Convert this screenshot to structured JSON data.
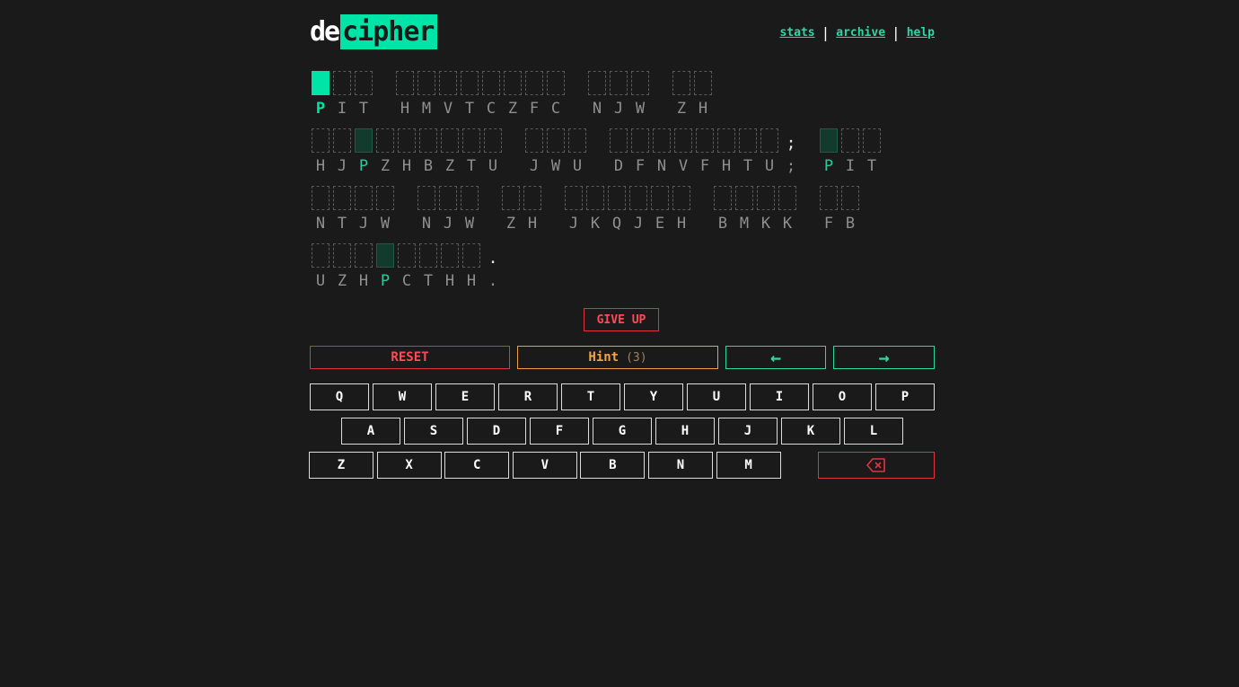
{
  "header": {
    "logo_de": "de",
    "logo_cipher": "cipher",
    "nav": {
      "stats": "stats",
      "archive": "archive",
      "help": "help",
      "sep": "|"
    }
  },
  "puzzle": {
    "lines": [
      {
        "words": [
          {
            "letters": [
              {
                "c": "P",
                "state": "active"
              },
              {
                "c": "I"
              },
              {
                "c": "T"
              }
            ]
          },
          {
            "letters": [
              {
                "c": "H"
              },
              {
                "c": "M"
              },
              {
                "c": "V"
              },
              {
                "c": "T"
              },
              {
                "c": "C"
              },
              {
                "c": "Z"
              },
              {
                "c": "F"
              },
              {
                "c": "C"
              }
            ]
          },
          {
            "letters": [
              {
                "c": "N"
              },
              {
                "c": "J"
              },
              {
                "c": "W"
              }
            ]
          },
          {
            "letters": [
              {
                "c": "Z"
              },
              {
                "c": "H"
              }
            ]
          }
        ]
      },
      {
        "words": [
          {
            "letters": [
              {
                "c": "H"
              },
              {
                "c": "J"
              },
              {
                "c": "P",
                "state": "match"
              },
              {
                "c": "Z"
              },
              {
                "c": "H"
              },
              {
                "c": "B"
              },
              {
                "c": "Z"
              },
              {
                "c": "T"
              },
              {
                "c": "U"
              }
            ]
          },
          {
            "letters": [
              {
                "c": "J"
              },
              {
                "c": "W"
              },
              {
                "c": "U"
              }
            ]
          },
          {
            "letters": [
              {
                "c": "D"
              },
              {
                "c": "F"
              },
              {
                "c": "N"
              },
              {
                "c": "V"
              },
              {
                "c": "F"
              },
              {
                "c": "H"
              },
              {
                "c": "T"
              },
              {
                "c": "U"
              }
            ],
            "punct": ";"
          },
          {
            "letters": [
              {
                "c": "P",
                "state": "match"
              },
              {
                "c": "I"
              },
              {
                "c": "T"
              }
            ]
          }
        ]
      },
      {
        "words": [
          {
            "letters": [
              {
                "c": "N"
              },
              {
                "c": "T"
              },
              {
                "c": "J"
              },
              {
                "c": "W"
              }
            ]
          },
          {
            "letters": [
              {
                "c": "N"
              },
              {
                "c": "J"
              },
              {
                "c": "W"
              }
            ]
          },
          {
            "letters": [
              {
                "c": "Z"
              },
              {
                "c": "H"
              }
            ]
          },
          {
            "letters": [
              {
                "c": "J"
              },
              {
                "c": "K"
              },
              {
                "c": "Q"
              },
              {
                "c": "J"
              },
              {
                "c": "E"
              },
              {
                "c": "H"
              }
            ]
          },
          {
            "letters": [
              {
                "c": "B"
              },
              {
                "c": "M"
              },
              {
                "c": "K"
              },
              {
                "c": "K"
              }
            ]
          },
          {
            "letters": [
              {
                "c": "F"
              },
              {
                "c": "B"
              }
            ]
          }
        ]
      },
      {
        "words": [
          {
            "letters": [
              {
                "c": "U"
              },
              {
                "c": "Z"
              },
              {
                "c": "H"
              },
              {
                "c": "P",
                "state": "match"
              },
              {
                "c": "C"
              },
              {
                "c": "T"
              },
              {
                "c": "H"
              },
              {
                "c": "H"
              }
            ],
            "punct": "."
          }
        ]
      }
    ]
  },
  "buttons": {
    "give_up": "GIVE UP",
    "reset": "RESET",
    "hint": "Hint",
    "hint_count": "(3)",
    "prev": "←",
    "next": "→"
  },
  "keyboard": {
    "row1": [
      "Q",
      "W",
      "E",
      "R",
      "T",
      "Y",
      "U",
      "I",
      "O",
      "P"
    ],
    "row2": [
      "A",
      "S",
      "D",
      "F",
      "G",
      "H",
      "J",
      "K",
      "L"
    ],
    "row3": [
      "Z",
      "X",
      "C",
      "V",
      "B",
      "N",
      "M"
    ],
    "backspace_icon": "backspace-icon"
  },
  "colors": {
    "background": "#1b1a1a",
    "accent": "#00e5a7",
    "danger": "#e0323f",
    "hint": "#f0a040"
  }
}
